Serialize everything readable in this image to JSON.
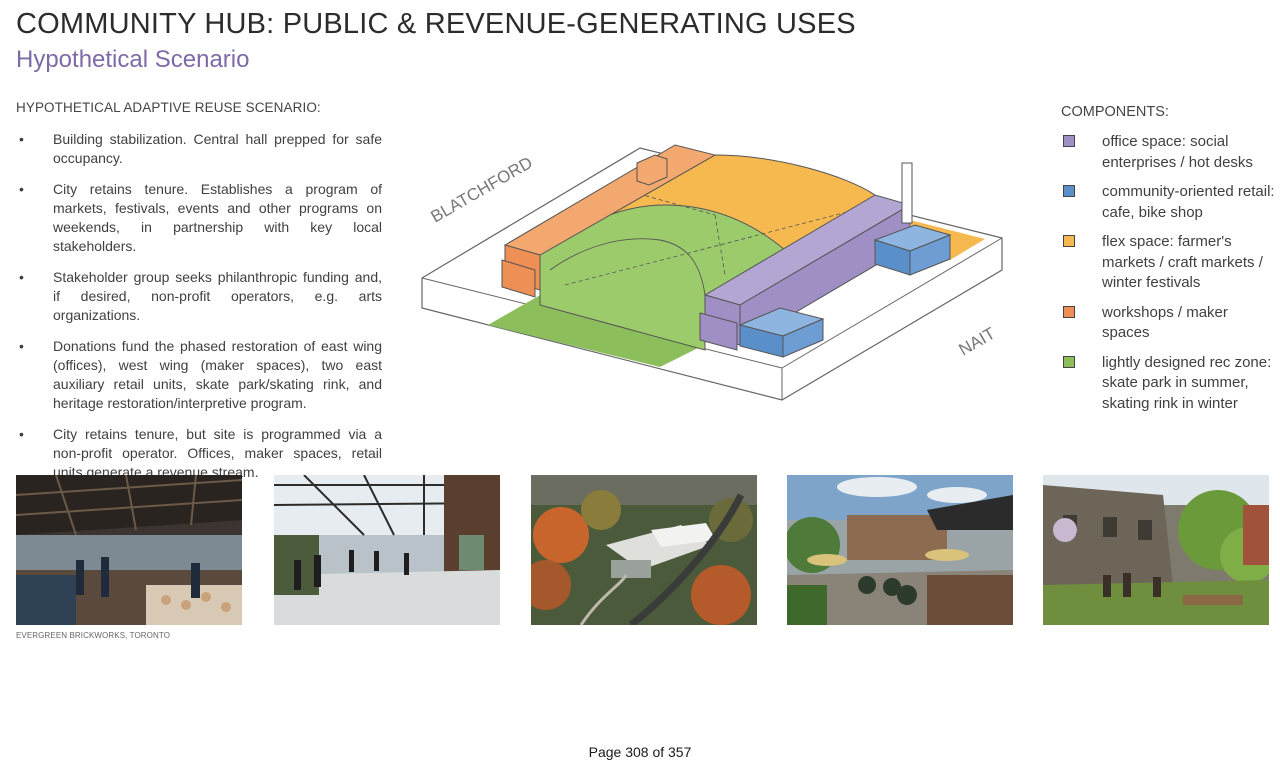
{
  "header": {
    "title": "COMMUNITY HUB: PUBLIC & REVENUE-GENERATING USES",
    "subtitle": "Hypothetical Scenario"
  },
  "scenario": {
    "heading": "HYPOTHETICAL ADAPTIVE REUSE SCENARIO:",
    "bullet_symbol": "•",
    "items": [
      "Building stabilization. Central hall prepped for safe occupancy.",
      "City retains tenure. Establishes a program of markets, festivals, events and other programs on weekends, in partnership with key local stakeholders.",
      "Stakeholder group seeks philanthropic funding and, if desired, non-profit operators, e.g. arts organizations.",
      "Donations fund the phased restoration of east wing (offices), west wing (maker spaces), two east auxiliary retail units, skate park/skating rink, and heritage restoration/interpretive program.",
      "City retains tenure, but site is programmed via a non-profit operator. Offices, maker spaces, retail units generate a revenue stream."
    ]
  },
  "diagram": {
    "labels": {
      "northwest": "BLATCHFORD",
      "southeast": "NAIT"
    }
  },
  "components": {
    "heading": "COMPONENTS:",
    "items": [
      {
        "label": "office space: social enterprises / hot desks",
        "color": "#9f8fc4"
      },
      {
        "label": "community-oriented retail: cafe, bike shop",
        "color": "#5b8fc9"
      },
      {
        "label": "flex space: farmer's markets / craft markets / winter festivals",
        "color": "#f5b94f"
      },
      {
        "label": "workshops / maker spaces",
        "color": "#ee8f55"
      },
      {
        "label": "lightly designed rec zone: skate park in summer, skating rink in winter",
        "color": "#8cbf5c"
      }
    ]
  },
  "photos": {
    "caption": "EVERGREEN BRICKWORKS, TORONTO",
    "items": [
      {
        "subject": "indoor-market-photo"
      },
      {
        "subject": "open-pavilion-photo"
      },
      {
        "subject": "aerial-site-photo"
      },
      {
        "subject": "outdoor-patio-photo"
      },
      {
        "subject": "garden-courtyard-photo"
      }
    ]
  },
  "footer": {
    "page_label": "Page 308 of 357"
  }
}
